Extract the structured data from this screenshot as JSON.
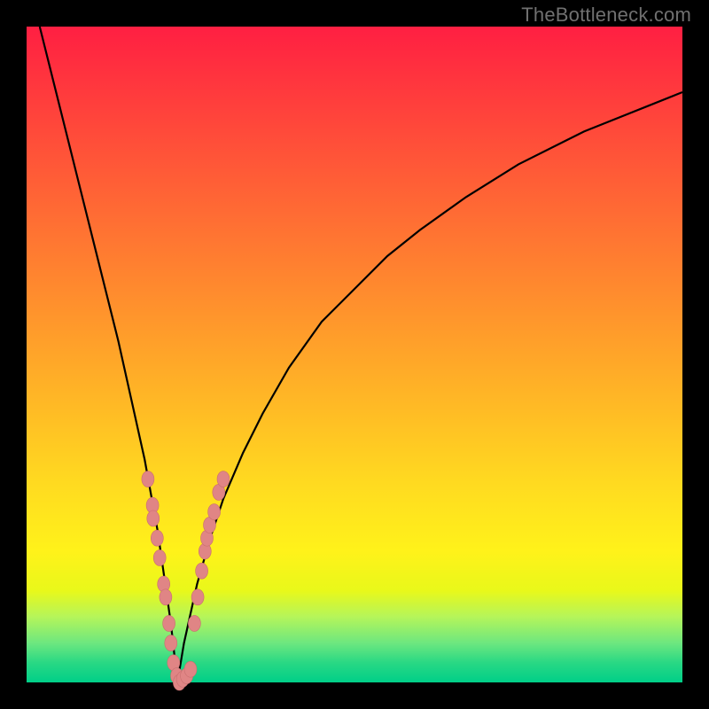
{
  "watermark": "TheBottleneck.com",
  "chart_data": {
    "type": "line",
    "title": "",
    "xlabel": "",
    "ylabel": "",
    "xlim": [
      0,
      100
    ],
    "ylim": [
      0,
      100
    ],
    "curve_minimum_x": 23,
    "background_gradient": [
      "#ff1f42",
      "#ff7a31",
      "#ffdb20",
      "#00cf88"
    ],
    "series": [
      {
        "name": "bottleneck-curve",
        "x": [
          2,
          4,
          6,
          8,
          10,
          12,
          14,
          16,
          18,
          20,
          22,
          23,
          24,
          26,
          28,
          30,
          33,
          36,
          40,
          45,
          50,
          55,
          60,
          67,
          75,
          85,
          95,
          100
        ],
        "y": [
          100,
          92,
          84,
          76,
          68,
          60,
          52,
          43,
          34,
          23,
          9,
          0,
          6,
          15,
          22,
          28,
          35,
          41,
          48,
          55,
          60,
          65,
          69,
          74,
          79,
          84,
          88,
          90
        ]
      }
    ],
    "data_points": {
      "name": "sample-points",
      "points": [
        {
          "x": 18.5,
          "y": 31
        },
        {
          "x": 19.2,
          "y": 27
        },
        {
          "x": 19.3,
          "y": 25
        },
        {
          "x": 19.9,
          "y": 22
        },
        {
          "x": 20.3,
          "y": 19
        },
        {
          "x": 20.9,
          "y": 15
        },
        {
          "x": 21.2,
          "y": 13
        },
        {
          "x": 21.7,
          "y": 9
        },
        {
          "x": 22.0,
          "y": 6
        },
        {
          "x": 22.4,
          "y": 3
        },
        {
          "x": 22.9,
          "y": 1
        },
        {
          "x": 23.3,
          "y": 0
        },
        {
          "x": 23.8,
          "y": 0.5
        },
        {
          "x": 24.4,
          "y": 1
        },
        {
          "x": 25.0,
          "y": 2
        },
        {
          "x": 25.6,
          "y": 9
        },
        {
          "x": 26.1,
          "y": 13
        },
        {
          "x": 26.7,
          "y": 17
        },
        {
          "x": 27.2,
          "y": 20
        },
        {
          "x": 27.5,
          "y": 22
        },
        {
          "x": 27.9,
          "y": 24
        },
        {
          "x": 28.6,
          "y": 26
        },
        {
          "x": 29.3,
          "y": 29
        },
        {
          "x": 30.0,
          "y": 31
        }
      ]
    }
  }
}
